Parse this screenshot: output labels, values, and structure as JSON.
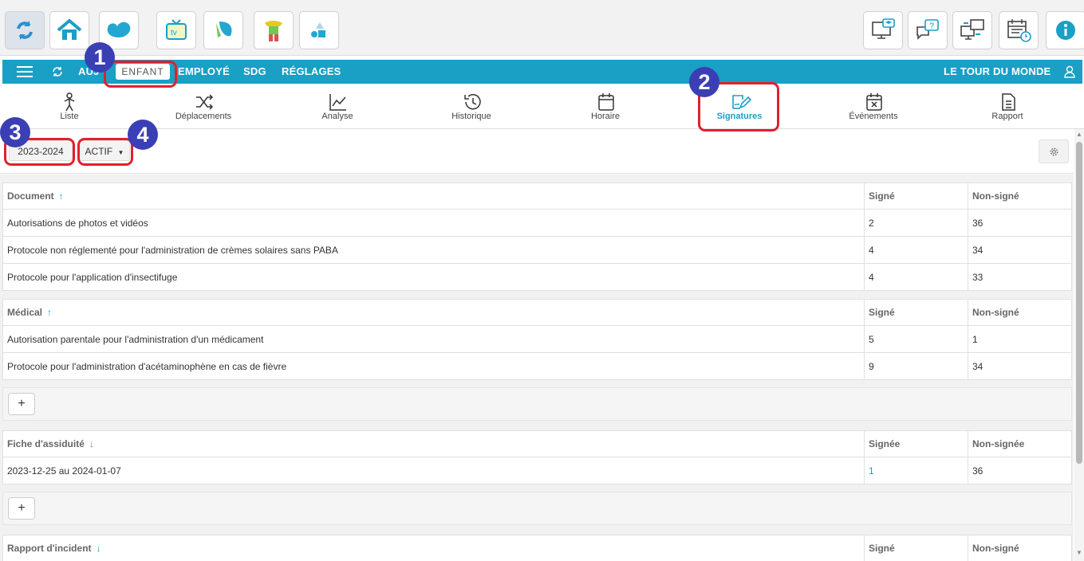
{
  "nav": {
    "auj": "AUJ",
    "enfant": "ENFANT",
    "employe": "EMPLOYÉ",
    "sdg": "SDG",
    "reglages": "RÉGLAGES",
    "location": "LE TOUR DU MONDE"
  },
  "tabs": [
    "Liste",
    "Déplacements",
    "Analyse",
    "Historique",
    "Horaire",
    "Signatures",
    "Événements",
    "Rapport"
  ],
  "active_tab": "Signatures",
  "filters": {
    "year": "2023-2024",
    "status": "ACTIF"
  },
  "sections": {
    "document": {
      "header": "Document",
      "col2": "Signé",
      "col3": "Non-signé",
      "rows": [
        {
          "name": "Autorisations de photos et vidéos",
          "signed": "2",
          "unsigned": "36"
        },
        {
          "name": "Protocole non réglementé pour l'administration de crèmes solaires sans PABA",
          "signed": "4",
          "unsigned": "34"
        },
        {
          "name": "Protocole pour l'application d'insectifuge",
          "signed": "4",
          "unsigned": "33"
        }
      ]
    },
    "medical": {
      "header": "Médical",
      "col2": "Signé",
      "col3": "Non-signé",
      "rows": [
        {
          "name": "Autorisation parentale pour l'administration d'un médicament",
          "signed": "5",
          "unsigned": "1"
        },
        {
          "name": "Protocole pour l'administration d'acétaminophène en cas de fièvre",
          "signed": "9",
          "unsigned": "34"
        }
      ]
    },
    "attendance": {
      "header": "Fiche d'assiduité",
      "col2": "Signée",
      "col3": "Non-signée",
      "rows": [
        {
          "name": "2023-12-25 au 2024-01-07",
          "signed": "1",
          "unsigned": "36"
        }
      ]
    },
    "incident": {
      "header": "Rapport d'incident",
      "col2": "Signé",
      "col3": "Non-signé"
    }
  },
  "plus_label": "+",
  "sort_up": "↑",
  "sort_down": "↓",
  "badges": [
    "1",
    "2",
    "3",
    "4"
  ],
  "colors": {
    "nav_blue": "#1a9fc5",
    "callout_red": "#e0202e",
    "badge_blue": "#3a3fb5"
  }
}
